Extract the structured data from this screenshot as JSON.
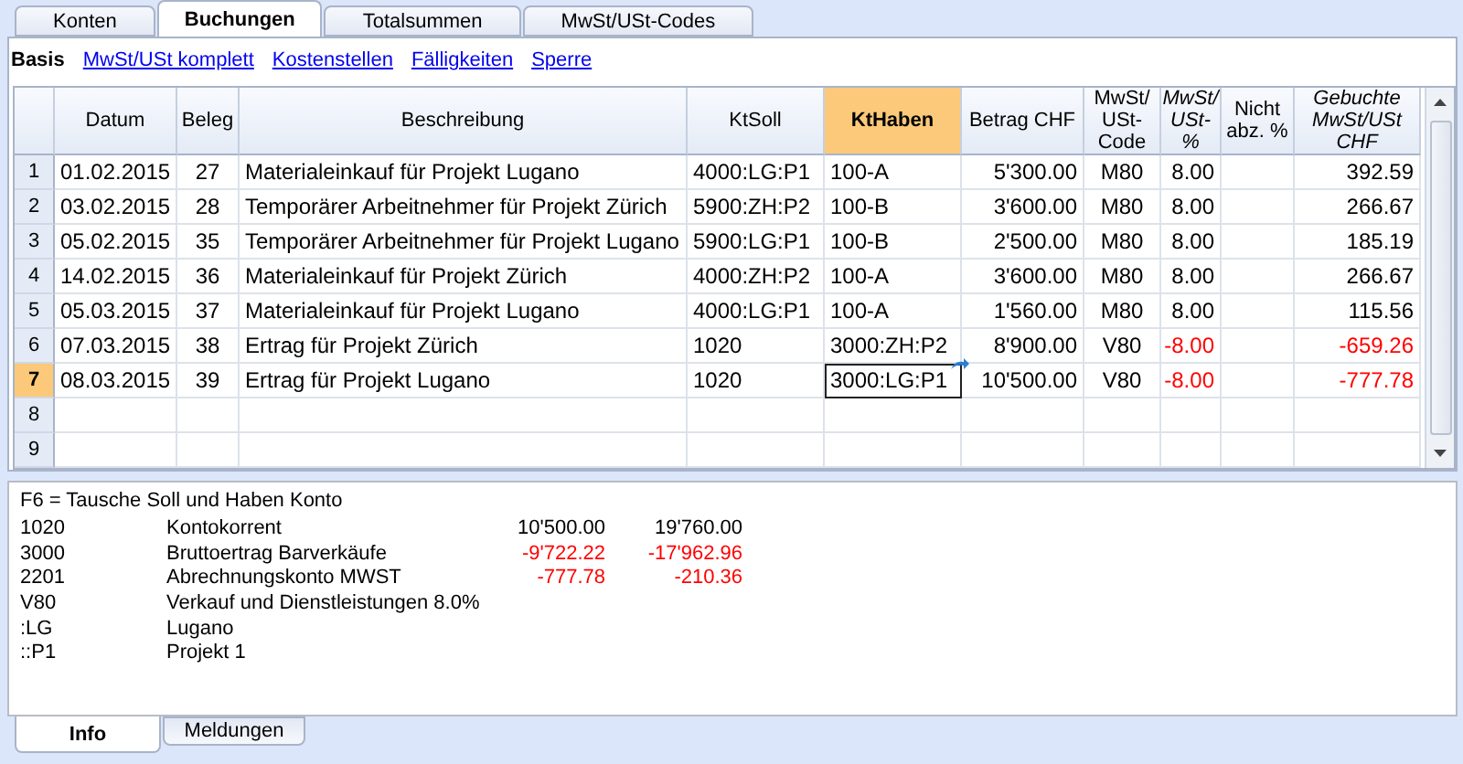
{
  "tabs": [
    {
      "label": "Konten",
      "selected": false
    },
    {
      "label": "Buchungen",
      "selected": true
    },
    {
      "label": "Totalsummen",
      "selected": false
    },
    {
      "label": "MwSt/USt-Codes",
      "selected": false
    }
  ],
  "views": [
    {
      "label": "Basis",
      "selected": true
    },
    {
      "label": "MwSt/USt komplett",
      "selected": false
    },
    {
      "label": "Kostenstellen",
      "selected": false
    },
    {
      "label": "Fälligkeiten",
      "selected": false
    },
    {
      "label": "Sperre",
      "selected": false
    }
  ],
  "table": {
    "columns": [
      {
        "label": "Datum",
        "italic": false,
        "selected": false
      },
      {
        "label": "Beleg",
        "italic": false,
        "selected": false
      },
      {
        "label": "Beschreibung",
        "italic": false,
        "selected": false
      },
      {
        "label": "KtSoll",
        "italic": false,
        "selected": false
      },
      {
        "label": "KtHaben",
        "italic": false,
        "selected": true
      },
      {
        "label": "Betrag CHF",
        "italic": false,
        "selected": false
      },
      {
        "label": "MwSt/ USt-Code",
        "italic": false,
        "selected": false
      },
      {
        "label": "MwSt/ USt-%",
        "italic": true,
        "selected": false
      },
      {
        "label": "Nicht abz. %",
        "italic": false,
        "selected": false
      },
      {
        "label": "Gebuchte MwSt/USt CHF",
        "italic": true,
        "selected": false
      }
    ],
    "rows": [
      {
        "number": "1",
        "selected": false,
        "negative": false,
        "cells": [
          "01.02.2015",
          "27",
          " Materialeinkauf für Projekt Lugano",
          "4000:LG:P1",
          "100-A",
          "5'300.00",
          "M80",
          "8.00",
          null,
          "392.59"
        ]
      },
      {
        "number": "2",
        "selected": false,
        "negative": false,
        "cells": [
          "03.02.2015",
          "28",
          "Temporärer Arbeitnehmer für Projekt Zürich",
          "5900:ZH:P2",
          "100-B",
          "3'600.00",
          "M80",
          "8.00",
          null,
          "266.67"
        ]
      },
      {
        "number": "3",
        "selected": false,
        "negative": false,
        "cells": [
          "05.02.2015",
          "35",
          "Temporärer Arbeitnehmer für Projekt Lugano",
          "5900:LG:P1",
          "100-B",
          "2'500.00",
          "M80",
          "8.00",
          null,
          "185.19"
        ]
      },
      {
        "number": "4",
        "selected": false,
        "negative": false,
        "cells": [
          "14.02.2015",
          "36",
          "Materialeinkauf für Projekt Zürich",
          "4000:ZH:P2",
          "100-A",
          "3'600.00",
          "M80",
          "8.00",
          null,
          "266.67"
        ]
      },
      {
        "number": "5",
        "selected": false,
        "negative": false,
        "cells": [
          "05.03.2015",
          "37",
          "Materialeinkauf für Projekt Lugano",
          "4000:LG:P1",
          "100-A",
          "1'560.00",
          "M80",
          "8.00",
          null,
          "115.56"
        ]
      },
      {
        "number": "6",
        "selected": false,
        "negative": true,
        "cells": [
          "07.03.2015",
          "38",
          "Ertrag für Projekt Zürich",
          "1020",
          "3000:ZH:P2",
          "8'900.00",
          "V80",
          "-8.00",
          null,
          "-659.26"
        ]
      },
      {
        "number": "7",
        "selected": true,
        "negative": true,
        "cells": [
          "08.03.2015",
          "39",
          "Ertrag für Projekt Lugano",
          "1020",
          "3000:LG:P1",
          "10'500.00",
          "V80",
          "-8.00",
          null,
          "-777.78"
        ]
      },
      {
        "number": "8",
        "selected": false
      },
      {
        "number": "9",
        "selected": false
      }
    ]
  },
  "info": {
    "title": "F6 = Tausche Soll und Haben Konto",
    "lines": [
      {
        "code": "1020",
        "name": "Kontokorrent",
        "amount_1": "10'500.00",
        "amount_2": "19'760.00",
        "negative": false
      },
      {
        "code": "3000",
        "name": "Bruttoertrag Barverkäufe",
        "amount_1": "-9'722.22",
        "amount_2": "-17'962.96",
        "negative": true
      },
      {
        "code": "2201",
        "name": "Abrechnungskonto MWST",
        "amount_1": "-777.78",
        "amount_2": "-210.36",
        "negative": true
      },
      {
        "code": "V80",
        "name": "Verkauf und Dienstleistungen 8.0%"
      },
      {
        "code": ":LG",
        "name": "Lugano"
      },
      {
        "code": "::P1",
        "name": "Projekt 1"
      }
    ]
  },
  "bottom_tabs": [
    {
      "label": "Info",
      "selected": true
    },
    {
      "label": "Meldungen",
      "selected": false
    }
  ]
}
